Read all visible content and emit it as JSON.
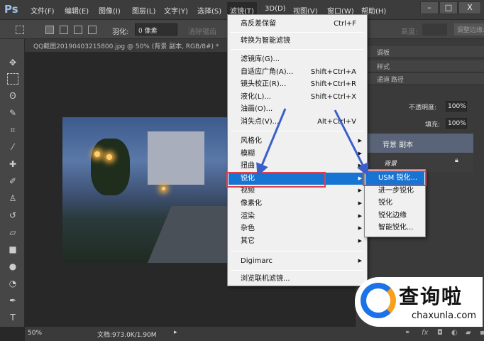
{
  "app": {
    "logo": "Ps",
    "menus": [
      "文件(F)",
      "编辑(E)",
      "图像(I)",
      "图层(L)",
      "文字(Y)",
      "选择(S)",
      "滤镜(T)",
      "3D(D)",
      "视图(V)",
      "窗口(W)",
      "帮助(H)"
    ],
    "window_buttons": [
      "–",
      "□",
      "X"
    ]
  },
  "options": {
    "feather_label": "羽化:",
    "feather_value": "0 像素",
    "antialias_label": "消除锯齿",
    "height_label": "高度:",
    "refine_edge": "调整边缘..."
  },
  "document": {
    "tab_title": "QQ截图20190403215800.jpg @ 50% (背景 副本, RGB/8#) *",
    "zoom": "50%",
    "doc_info": "文档:973.0K/1.90M"
  },
  "filter_menu": {
    "top": [
      {
        "label": "高反差保留",
        "shortcut": "Ctrl+F"
      }
    ],
    "smart": "转换为智能滤镜",
    "gallery": [
      {
        "label": "滤镜库(G)...",
        "shortcut": ""
      },
      {
        "label": "自适应广角(A)...",
        "shortcut": "Shift+Ctrl+A"
      },
      {
        "label": "镜头校正(R)...",
        "shortcut": "Shift+Ctrl+R"
      },
      {
        "label": "液化(L)...",
        "shortcut": "Shift+Ctrl+X"
      },
      {
        "label": "油画(O)...",
        "shortcut": ""
      },
      {
        "label": "消失点(V)...",
        "shortcut": "Alt+Ctrl+V"
      }
    ],
    "groups": [
      "风格化",
      "模糊",
      "扭曲",
      "锐化",
      "视频",
      "像素化",
      "渲染",
      "杂色",
      "其它"
    ],
    "digimarc": "Digimarc",
    "browse": "浏览联机滤镜..."
  },
  "sharpen_submenu": [
    "USM 锐化...",
    "进一步锐化",
    "锐化",
    "锐化边缘",
    "智能锐化..."
  ],
  "panels": {
    "tab1": "调板",
    "tab2": "样式",
    "tab3": "通道",
    "tab4": "路径",
    "opacity_label": "不透明度:",
    "opacity_value": "100%",
    "fill_label": "填充:",
    "fill_value": "100%",
    "layers": [
      "背景 副本",
      "背景"
    ]
  },
  "watermark": {
    "brand": "查询啦",
    "url": "chaxunla.com"
  },
  "colors": {
    "highlight": "#1874d2",
    "annotation": "#e0404a",
    "arrow": "#3a5fc8"
  }
}
